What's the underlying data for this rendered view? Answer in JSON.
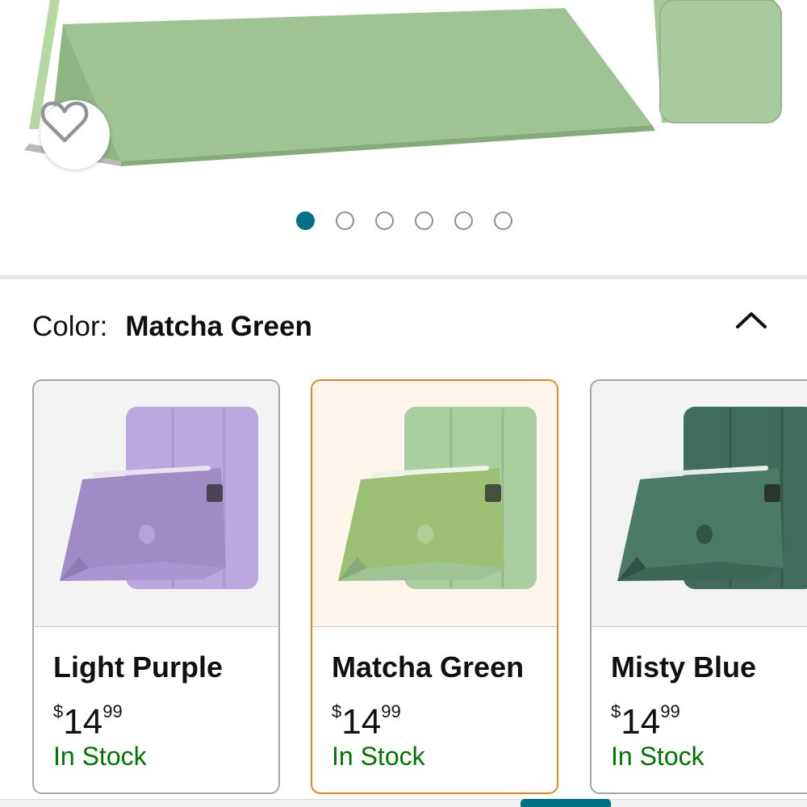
{
  "product_image": {
    "accent": "#a9cfa0",
    "icon": "wishlist-heart-icon"
  },
  "carousel": {
    "count": 6,
    "active_index": 0,
    "active_color": "#007185"
  },
  "color_selector": {
    "label": "Color:",
    "selected": "Matcha Green",
    "toggle_icon": "chevron-up-icon",
    "options": [
      {
        "name": "Light Purple",
        "currency": "$",
        "price_whole": "14",
        "price_fraction": "99",
        "availability": "In Stock",
        "color": "#b8a3da",
        "selected": false
      },
      {
        "name": "Matcha Green",
        "currency": "$",
        "price_whole": "14",
        "price_fraction": "99",
        "availability": "In Stock",
        "color": "#a9cfa0",
        "selected": true
      },
      {
        "name": "Misty Blue",
        "currency": "$",
        "price_whole": "14",
        "price_fraction": "99",
        "availability": "In Stock",
        "color": "#3e6b5c",
        "selected": false
      }
    ]
  },
  "colors": {
    "selected_border": "#e3861b",
    "in_stock": "#007600",
    "text": "#0f1111"
  }
}
